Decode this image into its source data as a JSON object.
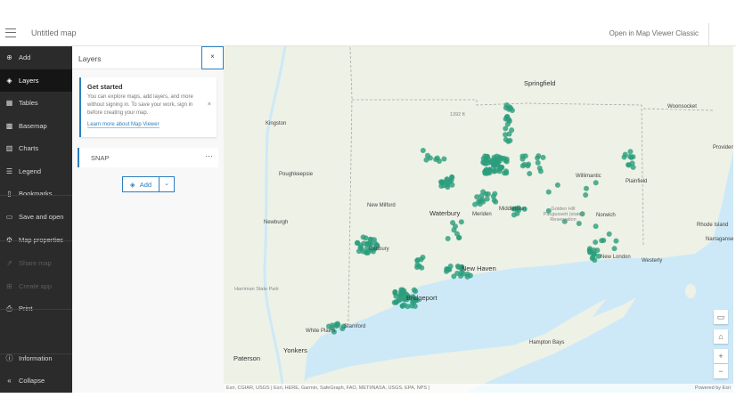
{
  "header": {
    "title": "Untitled map",
    "classic_link": "Open in Map Viewer Classic"
  },
  "sidebar": {
    "items": [
      {
        "label": "Add",
        "icon": "plus-circle-icon",
        "glyph": "⊕"
      },
      {
        "label": "Layers",
        "icon": "layers-icon",
        "glyph": "◈",
        "active": true
      },
      {
        "label": "Tables",
        "icon": "table-icon",
        "glyph": "▦"
      },
      {
        "label": "Basemap",
        "icon": "basemap-icon",
        "glyph": "▩"
      },
      {
        "label": "Charts",
        "icon": "chart-icon",
        "glyph": "▥"
      },
      {
        "label": "Legend",
        "icon": "legend-icon",
        "glyph": "☰"
      },
      {
        "label": "Bookmarks",
        "icon": "bookmark-icon",
        "glyph": "▯"
      },
      {
        "label": "Save and open",
        "icon": "folder-icon",
        "glyph": "▭"
      },
      {
        "label": "Map properties",
        "icon": "gear-icon",
        "glyph": "⚙"
      },
      {
        "label": "Share map",
        "icon": "share-icon",
        "glyph": "⇗",
        "disabled": true
      },
      {
        "label": "Create app",
        "icon": "apps-icon",
        "glyph": "⊞",
        "disabled": true
      },
      {
        "label": "Print",
        "icon": "print-icon",
        "glyph": "⎙"
      },
      {
        "label": "Information",
        "icon": "info-icon",
        "glyph": "ⓘ"
      },
      {
        "label": "Collapse",
        "icon": "collapse-icon",
        "glyph": "«"
      }
    ]
  },
  "panel": {
    "title": "Layers",
    "close": "×",
    "get_started": {
      "title": "Get started",
      "body": "You can explore maps, add layers, and more without signing in. To save your work, sign in before creating your map.",
      "link": "Learn more about Map Viewer",
      "dismiss": "×"
    },
    "layers": [
      {
        "name": "SNAP",
        "menu": "···"
      }
    ],
    "add_button": "Add",
    "add_dropdown": "⌄"
  },
  "map": {
    "labels": [
      "Springfield",
      "Kingston",
      "Poughkeepsie",
      "Newburgh",
      "New Milford",
      "Waterbury",
      "Meriden",
      "Middletown",
      "Willimantic",
      "Plainfield",
      "Norwich",
      "New London",
      "Westerly",
      "Woonsocket",
      "Providence",
      "Rhode Island",
      "Narragansett",
      "Danbury",
      "New Haven",
      "Bridgeport",
      "Stamford",
      "White Plains",
      "Yonkers",
      "Paterson",
      "Harriman State Park",
      "Golden Hill Paugussett (state) Reservation",
      "Hampton Bays",
      "1392 ft"
    ],
    "controls": {
      "screen": "▭",
      "home": "⌂",
      "zoom_in": "+",
      "zoom_out": "−"
    },
    "attribution": "Esri, CGIAR, USGS | Esri, HERE, Garmin, SafeGraph, FAO, METI/NASA, USGS, EPA, NPS |",
    "powered_by": "Powered by Esri",
    "point_color": "#2a9d7c",
    "water_color": "#cde9f7"
  }
}
